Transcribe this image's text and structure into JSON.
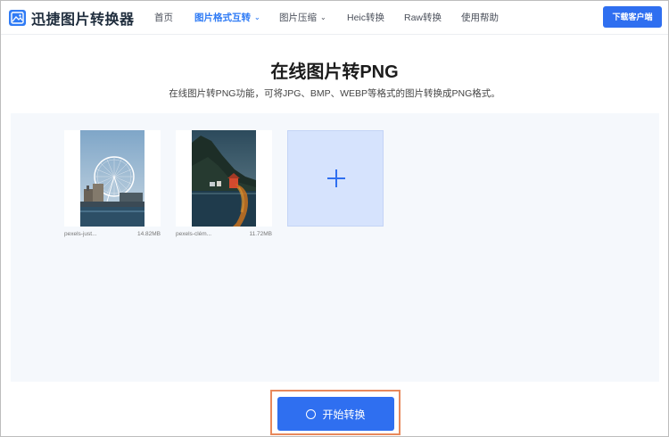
{
  "header": {
    "logo_text": "迅捷图片转换器",
    "nav": [
      {
        "label": "首页",
        "active": false,
        "dropdown": false
      },
      {
        "label": "图片格式互转",
        "active": true,
        "dropdown": true
      },
      {
        "label": "图片压缩",
        "active": false,
        "dropdown": true
      },
      {
        "label": "Heic转换",
        "active": false,
        "dropdown": false
      },
      {
        "label": "Raw转换",
        "active": false,
        "dropdown": false
      },
      {
        "label": "使用帮助",
        "active": false,
        "dropdown": false
      }
    ],
    "download_label": "下载客户端"
  },
  "main": {
    "title": "在线图片转PNG",
    "subtitle": "在线图片转PNG功能，可将JPG、BMP、WEBP等格式的图片转换成PNG格式。"
  },
  "files": [
    {
      "name": "pexels-just...",
      "size": "14.82MB",
      "image": "ferris-wheel-photo"
    },
    {
      "name": "pexels-clém...",
      "size": "11.72MB",
      "image": "coastal-cliff-photo"
    }
  ],
  "add_icon": "plus-icon",
  "start_label": "开始转换",
  "colors": {
    "accent": "#2f6ff0",
    "highlight_border": "#e8895c",
    "upload_bg": "#f5f8fc",
    "add_tile_bg": "#d6e3fd"
  }
}
